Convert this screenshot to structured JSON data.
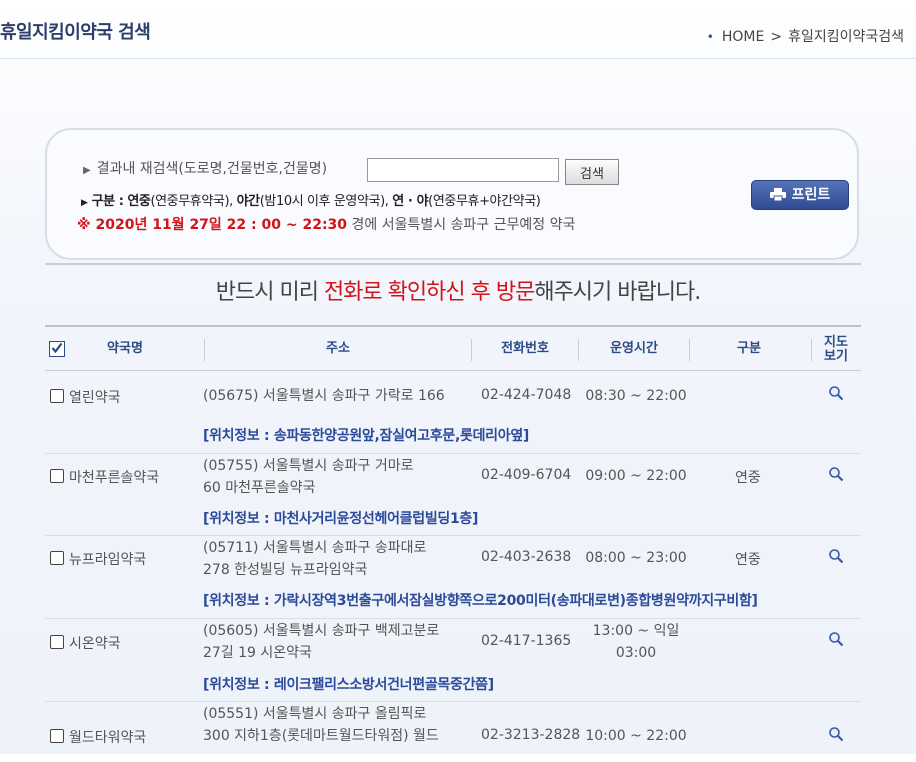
{
  "header": {
    "title": "휴일지킴이약국 검색",
    "breadcrumb": {
      "home": "HOME",
      "separator": ">",
      "current": "휴일지킴이약국검색"
    }
  },
  "search": {
    "label": "결과내 재검색(도로명,건물번호,건물명)",
    "input_value": "",
    "button_label": "검색",
    "legend": {
      "prefix": "구분 :",
      "a_term": "연중",
      "a_desc": "(연중무휴약국),",
      "b_term": "야간",
      "b_desc": "(밤10시 이후 운영약국),",
      "c_term": "연 · 야",
      "c_desc": "(연중무휴+야간약국)"
    },
    "datetime": "※ 2020년 11월 27일 22 : 00 ~ 22:30",
    "region_text": "경에  서울특별시  송파구    근무예정 약국"
  },
  "print_button": "프린트",
  "notice": {
    "part1": "반드시 미리 ",
    "highlight": "전화로 확인하신 후 방문",
    "part2": "해주시기 바랍니다."
  },
  "table": {
    "headers": {
      "name": "약국명",
      "address": "주소",
      "phone": "전화번호",
      "hours": "운영시간",
      "type": "구분",
      "map_line1": "지도",
      "map_line2": "보기"
    },
    "rows": [
      {
        "name": "열린약국",
        "addr1": "(05675) 서울특별시 송파구 가락로 166",
        "addr2": "",
        "phone": "02-424-7048",
        "hours1": "08:30 ~ 22:00",
        "hours2": "",
        "type": "",
        "location": "[위치정보 : 송파동한양공원앞,잠실여고후문,롯데리아옆]"
      },
      {
        "name": "마천푸른솔약국",
        "addr1": "(05755) 서울특별시 송파구 거마로",
        "addr2": "60 마천푸른솔약국",
        "phone": "02-409-6704",
        "hours1": "09:00 ~ 22:00",
        "hours2": "",
        "type": "연중",
        "location": "[위치정보 : 마천사거리윤정선헤어클럽빌딩1층]"
      },
      {
        "name": "뉴프라임약국",
        "addr1": "(05711) 서울특별시 송파구 송파대로",
        "addr2": "278 한성빌딩 뉴프라임약국",
        "phone": "02-403-2638",
        "hours1": "08:00 ~ 23:00",
        "hours2": "",
        "type": "연중",
        "location": "[위치정보 : 가락시장역3번출구에서잠실방향쪽으로200미터(송파대로변)종합병원약까지구비함]"
      },
      {
        "name": "시온약국",
        "addr1": "(05605) 서울특별시 송파구 백제고분로",
        "addr2": "27길 19 시온약국",
        "phone": "02-417-1365",
        "hours1": "13:00 ~ 익일",
        "hours2": "03:00",
        "type": "",
        "location": "[위치정보 : 레이크팰리스소방서건너편골목중간쯤]"
      },
      {
        "name": "월드타워약국",
        "addr1": "(05551) 서울특별시 송파구 올림픽로",
        "addr2": "300 지하1층(롯데마트월드타워점) 월드",
        "phone": "02-3213-2828",
        "hours1": "10:00 ~ 22:00",
        "hours2": "",
        "type": "",
        "location": ""
      }
    ]
  },
  "colors": {
    "accent": "#2c4a84",
    "alert": "#d2141a",
    "print_button": "#3a58a2"
  }
}
